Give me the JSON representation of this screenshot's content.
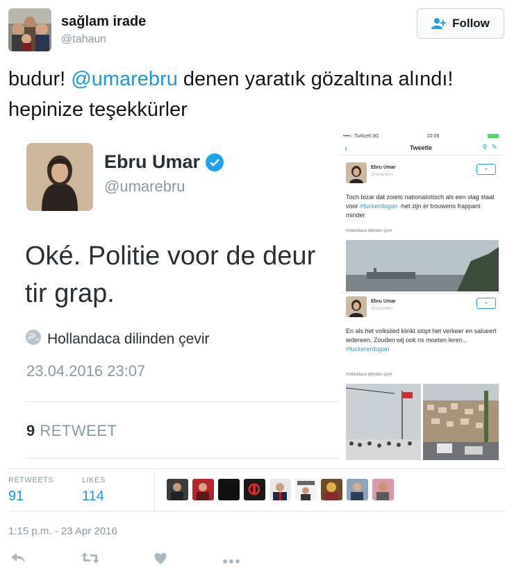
{
  "author": {
    "name": "sağlam irade",
    "handle": "@tahaun"
  },
  "follow_button": {
    "label": "Follow",
    "icon": "add-user-icon"
  },
  "tweet": {
    "text_before": "budur! ",
    "mention": "@umarebru",
    "text_after": " denen yaratık gözaltına alındı! hepinize teşekkürler"
  },
  "embedded": {
    "name": "Ebru Umar",
    "handle": "@umarebru",
    "text": "Oké. Politie voor de deur tir grap.",
    "translate": "Hollandaca dilinden çevir",
    "date": "23.04.2016 23:07",
    "retweet_count": "9",
    "retweet_label": "RETWEET",
    "phone": {
      "status_left": "••••○ Turkcell  3G",
      "status_time": "22:09",
      "nav_title": "Tweetle",
      "tweet1": {
        "name": "Ebru Umar",
        "handle": "@umarebru",
        "text_before": "Toch bizar dat zoiets nationalistisch als een vlag staat voor ",
        "tag": "#fuckerdogan",
        "text_after": " -het zijn er trouwens frappant minder",
        "translate": "Hollandaca dilinden çevir"
      },
      "tweet2": {
        "name": "Ebru Umar",
        "handle": "@umarebru",
        "text": "En als het volkslied klinkt stopt het verkeer en salueert iedereen. Zouden wij ook ns moeten leren...",
        "tag": "#fuckererdogan",
        "translate": "Hollandaca dilinden çevir"
      }
    }
  },
  "stats": {
    "retweets_label": "RETWEETS",
    "retweets_value": "91",
    "likes_label": "LIKES",
    "likes_value": "114"
  },
  "timestamp": "1:15 p.m. - 23 Apr 2016",
  "actions": [
    "reply-icon",
    "retweet-icon",
    "like-icon",
    "more-icon"
  ],
  "colors": {
    "link": "#1b95e0",
    "muted": "#8899a6",
    "text": "#14171a"
  }
}
